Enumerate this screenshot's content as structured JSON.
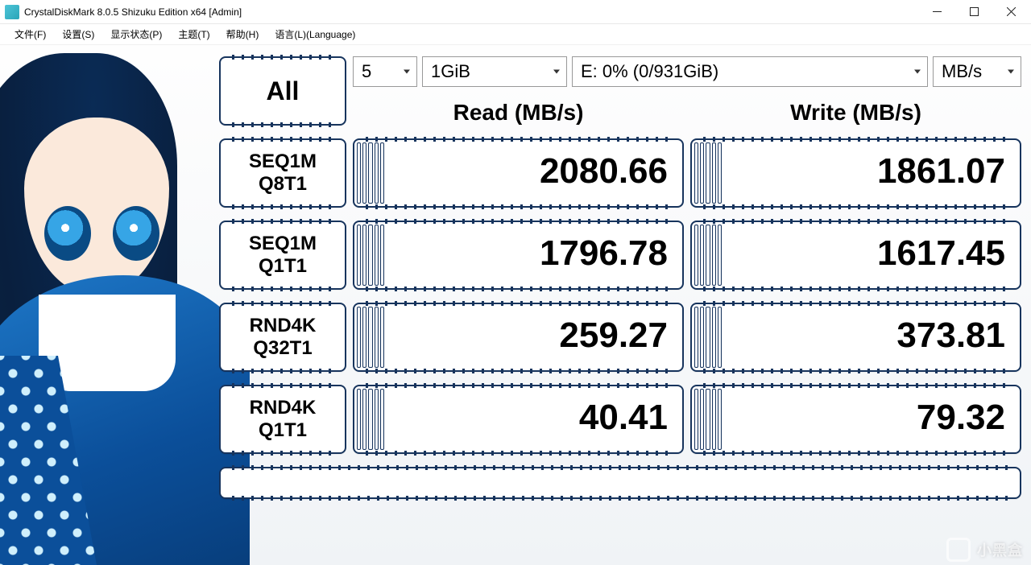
{
  "window": {
    "title": "CrystalDiskMark 8.0.5 Shizuku Edition x64 [Admin]"
  },
  "menu": {
    "file": "文件(F)",
    "settings": "设置(S)",
    "show_status": "显示状态(P)",
    "theme": "主题(T)",
    "help": "帮助(H)",
    "language": "语言(L)(Language)"
  },
  "controls": {
    "runs": "5",
    "size": "1GiB",
    "drive": "E: 0% (0/931GiB)",
    "unit": "MB/s"
  },
  "buttons": {
    "all": "All",
    "tests": [
      {
        "line1": "SEQ1M",
        "line2": "Q8T1"
      },
      {
        "line1": "SEQ1M",
        "line2": "Q1T1"
      },
      {
        "line1": "RND4K",
        "line2": "Q32T1"
      },
      {
        "line1": "RND4K",
        "line2": "Q1T1"
      }
    ]
  },
  "headers": {
    "read": "Read (MB/s)",
    "write": "Write (MB/s)"
  },
  "results": {
    "read": [
      "2080.66",
      "1796.78",
      "259.27",
      "40.41"
    ],
    "write": [
      "1861.07",
      "1617.45",
      "373.81",
      "79.32"
    ]
  },
  "watermark": "小黑盒"
}
